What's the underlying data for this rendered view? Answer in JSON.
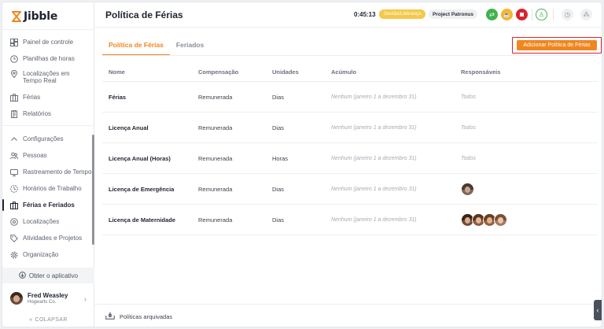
{
  "brand": {
    "name": "Jibble"
  },
  "sidebar": {
    "items_top": [
      {
        "label": "Painel de controle",
        "icon": "dashboard-icon"
      },
      {
        "label": "Planilhas de horas",
        "icon": "clock-icon"
      },
      {
        "label": "Localizações em Tempo Real",
        "icon": "map-pin-icon"
      },
      {
        "label": "Férias",
        "icon": "suitcase-icon"
      },
      {
        "label": "Relatórios",
        "icon": "report-icon"
      }
    ],
    "items_config": [
      {
        "label": "Configurações",
        "icon": "chevron-up-icon"
      },
      {
        "label": "Pessoas",
        "icon": "people-icon"
      },
      {
        "label": "Rastreamento de Tempo",
        "icon": "time-tracking-icon"
      },
      {
        "label": "Horários de Trabalho",
        "icon": "work-schedule-icon"
      },
      {
        "label": "Férias e Feriados",
        "icon": "suitcase-icon"
      },
      {
        "label": "Localizações",
        "icon": "location-icon"
      },
      {
        "label": "Atividades e Projetos",
        "icon": "tag-icon"
      },
      {
        "label": "Organização",
        "icon": "gear-icon"
      }
    ],
    "get_app": "Obter o aplicativo",
    "user": {
      "name": "Fred Weasley",
      "org": "Hogwarts Co."
    },
    "collapse": "COLAPSAR"
  },
  "header": {
    "title": "Política de Férias",
    "timer": "0:45:13",
    "activity_badge": "Gestão/Liderança",
    "project_badge": "Project Patronus"
  },
  "tabs": [
    {
      "label": "Política de Férias",
      "active": true
    },
    {
      "label": "Feriados",
      "active": false
    }
  ],
  "add_button": "Adicionar Política de Férias",
  "table": {
    "columns": [
      "Nome",
      "Compensação",
      "Unidades",
      "Acúmulo",
      "Responsáveis"
    ],
    "rows": [
      {
        "name": "Férias",
        "comp": "Remunerada",
        "unit": "Dias",
        "accrual": "Nenhum (janeiro 1 a dezembro 31)",
        "resp": "Todos"
      },
      {
        "name": "Licença Anual",
        "comp": "Remunerada",
        "unit": "Dias",
        "accrual": "Nenhum (janeiro 1 a dezembro 31)",
        "resp": "Todos"
      },
      {
        "name": "Licença Anual (Horas)",
        "comp": "Remunerada",
        "unit": "Horas",
        "accrual": "Nenhum (janeiro 1 a dezembro 31)",
        "resp": "Todos"
      },
      {
        "name": "Licença de Emergência",
        "comp": "Remunerada",
        "unit": "Dias",
        "accrual": "Nenhum (janeiro 1 a dezembro 31)",
        "resp": ""
      },
      {
        "name": "Licença de Maternidade",
        "comp": "Remunerada",
        "unit": "Dias",
        "accrual": "Nenhum (janeiro 1 a dezembro 31)",
        "resp": ""
      }
    ]
  },
  "footer": {
    "archived": "Políticas arquivadas"
  },
  "colors": {
    "accent": "#f0861f",
    "highlight": "#d9232e",
    "green": "#3fb34f",
    "yellow": "#f5c84a",
    "red": "#d9232e"
  }
}
